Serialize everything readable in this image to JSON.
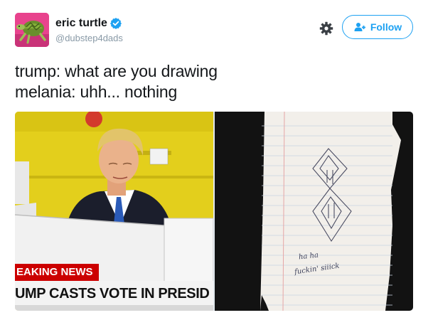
{
  "user": {
    "display_name": "eric turtle",
    "handle": "@dubstep4dads",
    "verified": true
  },
  "actions": {
    "follow_label": "Follow",
    "settings_icon": "gear-icon",
    "follow_icon": "add-user-icon"
  },
  "tweet": {
    "lines": [
      "trump: what are you drawing",
      "melania: uhh... nothing"
    ]
  },
  "media": {
    "left_image": {
      "ticker_red": "EAKING NEWS",
      "ticker_white": "UMP CASTS VOTE IN PRESID"
    },
    "right_image": {
      "note_line_1": "ha  ha",
      "note_line_2": "fuckin'  siiick"
    }
  },
  "colors": {
    "accent": "#1da1f2",
    "text": "#14171a",
    "secondary": "#8899a6",
    "news_red": "#cc0000",
    "wall_yellow": "#e6d21a"
  }
}
